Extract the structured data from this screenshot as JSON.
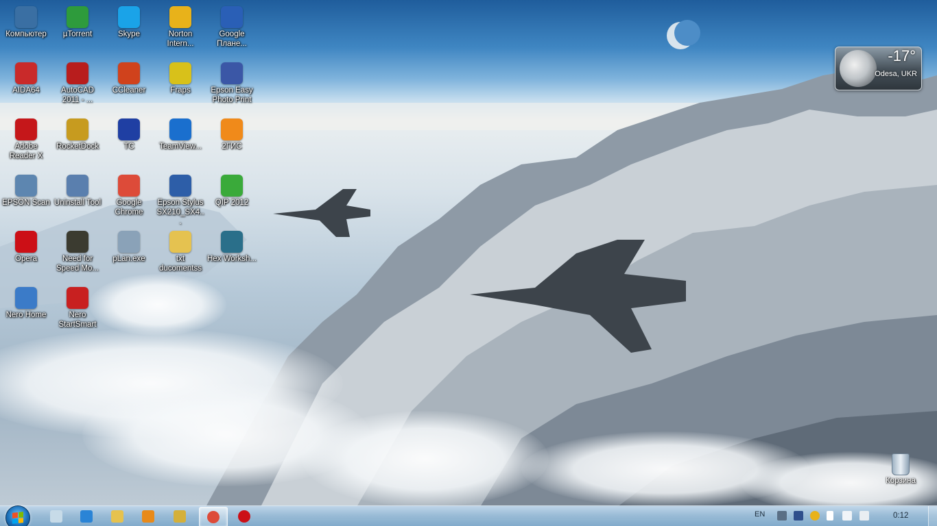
{
  "desktop": {
    "icons": [
      {
        "label": "Компьютер",
        "icon": "computer-icon",
        "color": "#3a6fa3"
      },
      {
        "label": "µTorrent",
        "icon": "utorrent-icon",
        "color": "#2e9b3c"
      },
      {
        "label": "Skype",
        "icon": "skype-icon",
        "color": "#1aa3e8"
      },
      {
        "label": "Norton Intern...",
        "icon": "norton-icon",
        "color": "#e8b21a"
      },
      {
        "label": "Google Плане...",
        "icon": "google-earth-icon",
        "color": "#2a5fb6"
      },
      {
        "label": "AIDA64",
        "icon": "aida64-icon",
        "color": "#c92a2a"
      },
      {
        "label": "AutoCAD 2011 - ...",
        "icon": "autocad-icon",
        "color": "#b81d1d"
      },
      {
        "label": "CCleaner",
        "icon": "ccleaner-icon",
        "color": "#d0421c"
      },
      {
        "label": "Fraps",
        "icon": "fraps-icon",
        "color": "#d8c11a"
      },
      {
        "label": "Epson Easy Photo Print",
        "icon": "epson-photo-icon",
        "color": "#3b57a6"
      },
      {
        "label": "Adobe Reader X",
        "icon": "adobe-reader-icon",
        "color": "#c5171a"
      },
      {
        "label": "RocketDock",
        "icon": "rocketdock-icon",
        "color": "#c79b1f"
      },
      {
        "label": "TC",
        "icon": "total-commander-icon",
        "color": "#1f3fa3"
      },
      {
        "label": "TeamView...",
        "icon": "teamviewer-icon",
        "color": "#1a6fce"
      },
      {
        "label": "2ГИС",
        "icon": "2gis-icon",
        "color": "#f08a1a"
      },
      {
        "label": "EPSON Scan",
        "icon": "epson-scan-icon",
        "color": "#5d86b0"
      },
      {
        "label": "Uninstall Tool",
        "icon": "uninstall-tool-icon",
        "color": "#5a7fae"
      },
      {
        "label": "Google Chrome",
        "icon": "chrome-icon",
        "color": "#dd4b39"
      },
      {
        "label": "Epson Stylus SX210_SX4...",
        "icon": "epson-stylus-icon",
        "color": "#2d5ea8"
      },
      {
        "label": "QIP 2012",
        "icon": "qip-icon",
        "color": "#3aaa3a"
      },
      {
        "label": "Opera",
        "icon": "opera-icon",
        "color": "#cc0f16"
      },
      {
        "label": "Need for Speed Mo...",
        "icon": "nfs-icon",
        "color": "#3b3b30"
      },
      {
        "label": "pLan.exe",
        "icon": "plan-icon",
        "color": "#8aa2b8"
      },
      {
        "label": "txt ducomentss",
        "icon": "folder-icon",
        "color": "#e5c250"
      },
      {
        "label": "Hex Worksh...",
        "icon": "hex-workshop-icon",
        "color": "#2a6f8a"
      },
      {
        "label": "Nero Home",
        "icon": "nero-home-icon",
        "color": "#3b7bc8"
      },
      {
        "label": "Nero StartSmart",
        "icon": "nero-startsmart-icon",
        "color": "#c82020"
      }
    ],
    "recycle_bin": {
      "label": "Корзина"
    }
  },
  "weather": {
    "temp": "-17°",
    "city": "Odesa, UKR"
  },
  "taskbar": {
    "items": [
      {
        "name": "notepad",
        "color": "#c7dbe8",
        "active": false
      },
      {
        "name": "internet-explorer",
        "color": "#2a84d6",
        "active": false
      },
      {
        "name": "explorer",
        "color": "#e6c24e",
        "active": false
      },
      {
        "name": "media-player",
        "color": "#e88a1a",
        "active": false
      },
      {
        "name": "pen-tool",
        "color": "#d4b03a",
        "active": false
      },
      {
        "name": "chrome",
        "color": "#dd4b39",
        "active": true
      },
      {
        "name": "opera",
        "color": "#cc0f16",
        "active": false
      }
    ],
    "language": "EN",
    "clock": "0:12"
  }
}
